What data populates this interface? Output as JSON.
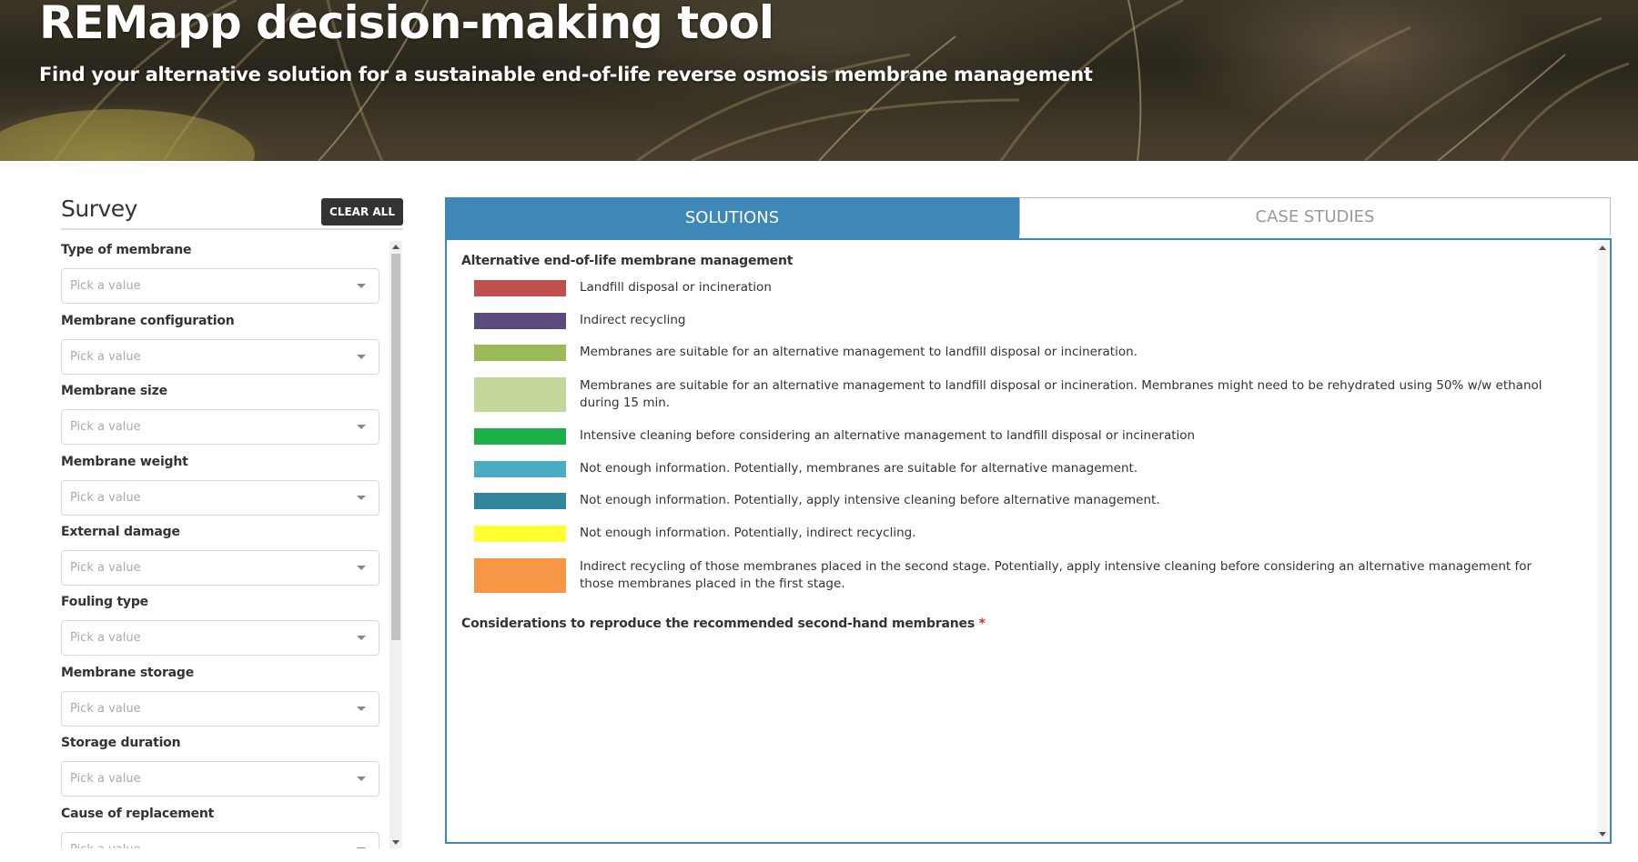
{
  "header": {
    "title": "REMapp decision-making tool",
    "subtitle": "Find your alternative solution for a sustainable end-of-life reverse osmosis membrane management"
  },
  "survey": {
    "title": "Survey",
    "clear_label": "CLEAR ALL",
    "placeholder": "Pick a value",
    "fields": [
      {
        "label": "Type of membrane"
      },
      {
        "label": "Membrane configuration"
      },
      {
        "label": "Membrane size"
      },
      {
        "label": "Membrane weight"
      },
      {
        "label": "External damage"
      },
      {
        "label": "Fouling type"
      },
      {
        "label": "Membrane storage"
      },
      {
        "label": "Storage duration"
      },
      {
        "label": "Cause of replacement"
      }
    ]
  },
  "tabs": {
    "solutions": "SOLUTIONS",
    "case_studies": "CASE STUDIES",
    "active": "SOLUTIONS"
  },
  "solutions": {
    "legend_title": "Alternative end-of-life membrane management",
    "legend": [
      {
        "color": "#c0504d",
        "text": "Landfill disposal or incineration"
      },
      {
        "color": "#5b4a7e",
        "text": "Indirect recycling"
      },
      {
        "color": "#9bbb59",
        "text": "Membranes are suitable for an alternative management to landfill disposal or incineration."
      },
      {
        "color": "#c4d79b",
        "text": "Membranes are suitable for an alternative management to landfill disposal or incineration. Membranes might need to be rehydrated using 50% w/w ethanol during 15 min."
      },
      {
        "color": "#1db04a",
        "text": "Intensive cleaning before considering an alternative management to landfill disposal or incineration"
      },
      {
        "color": "#4bacc6",
        "text": "Not enough information. Potentially, membranes are suitable for alternative management."
      },
      {
        "color": "#31859c",
        "text": "Not enough information. Potentially, apply intensive cleaning before alternative management."
      },
      {
        "color": "#ffff33",
        "text": "Not enough information. Potentially, indirect recycling."
      },
      {
        "color": "#f79646",
        "text": "Indirect recycling of those membranes placed in the second stage. Potentially, apply intensive cleaning before considering an alternative management for those membranes placed in the first stage."
      }
    ],
    "considerations_title": "Considerations to reproduce the recommended second-hand membranes",
    "required_mark": "*"
  }
}
